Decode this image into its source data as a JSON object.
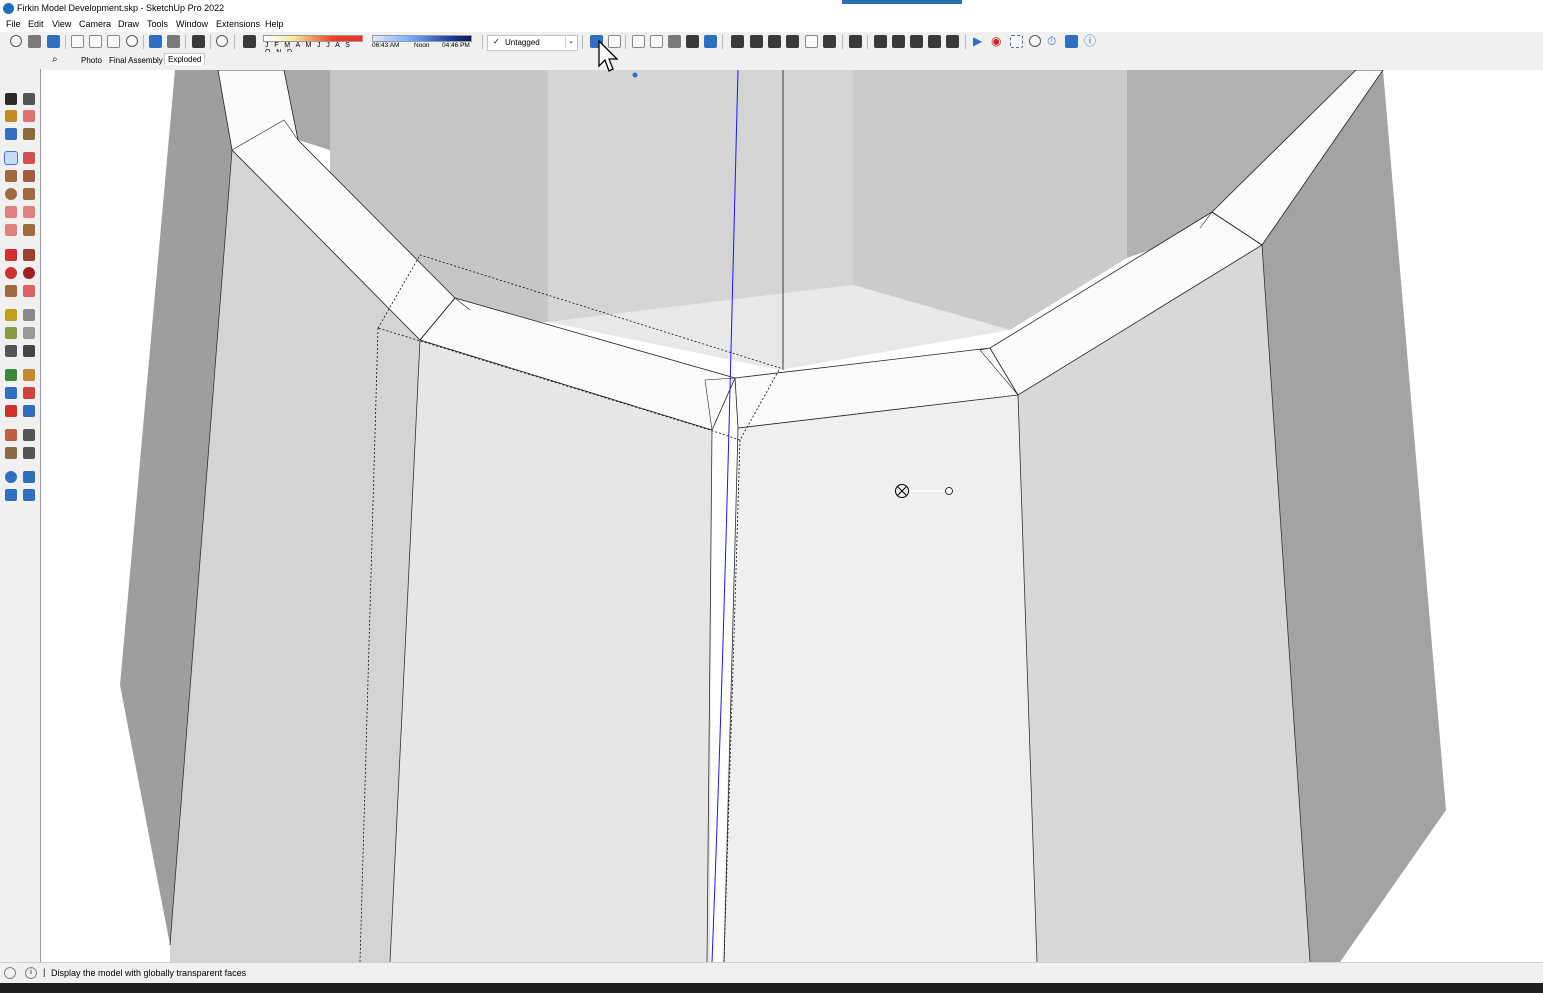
{
  "window": {
    "title": "Firkin Model Development.skp - SketchUp Pro 2022"
  },
  "menu": [
    "File",
    "Edit",
    "View",
    "Camera",
    "Draw",
    "Tools",
    "Window",
    "Extensions",
    "Help"
  ],
  "shadow": {
    "months": "J F M A M J J A S O N D",
    "time_start": "06:43 AM",
    "time_mid": "Noon",
    "time_end": "04:46 PM"
  },
  "tag": {
    "check": "✓",
    "value": "Untagged",
    "dropdown": "⌄"
  },
  "scenes": {
    "search": "⌕",
    "tabs": [
      "Photo",
      "Final Assembly",
      "Exploded"
    ],
    "selected": "Exploded"
  },
  "status": {
    "message": "Display the model with globally transparent faces"
  },
  "colors": {
    "accent": "#2f6fc0",
    "axis_blue": "#1a1aff",
    "face_light": "#efefef",
    "face_mid": "#d8d8d8",
    "face_dark": "#9f9f9f"
  }
}
